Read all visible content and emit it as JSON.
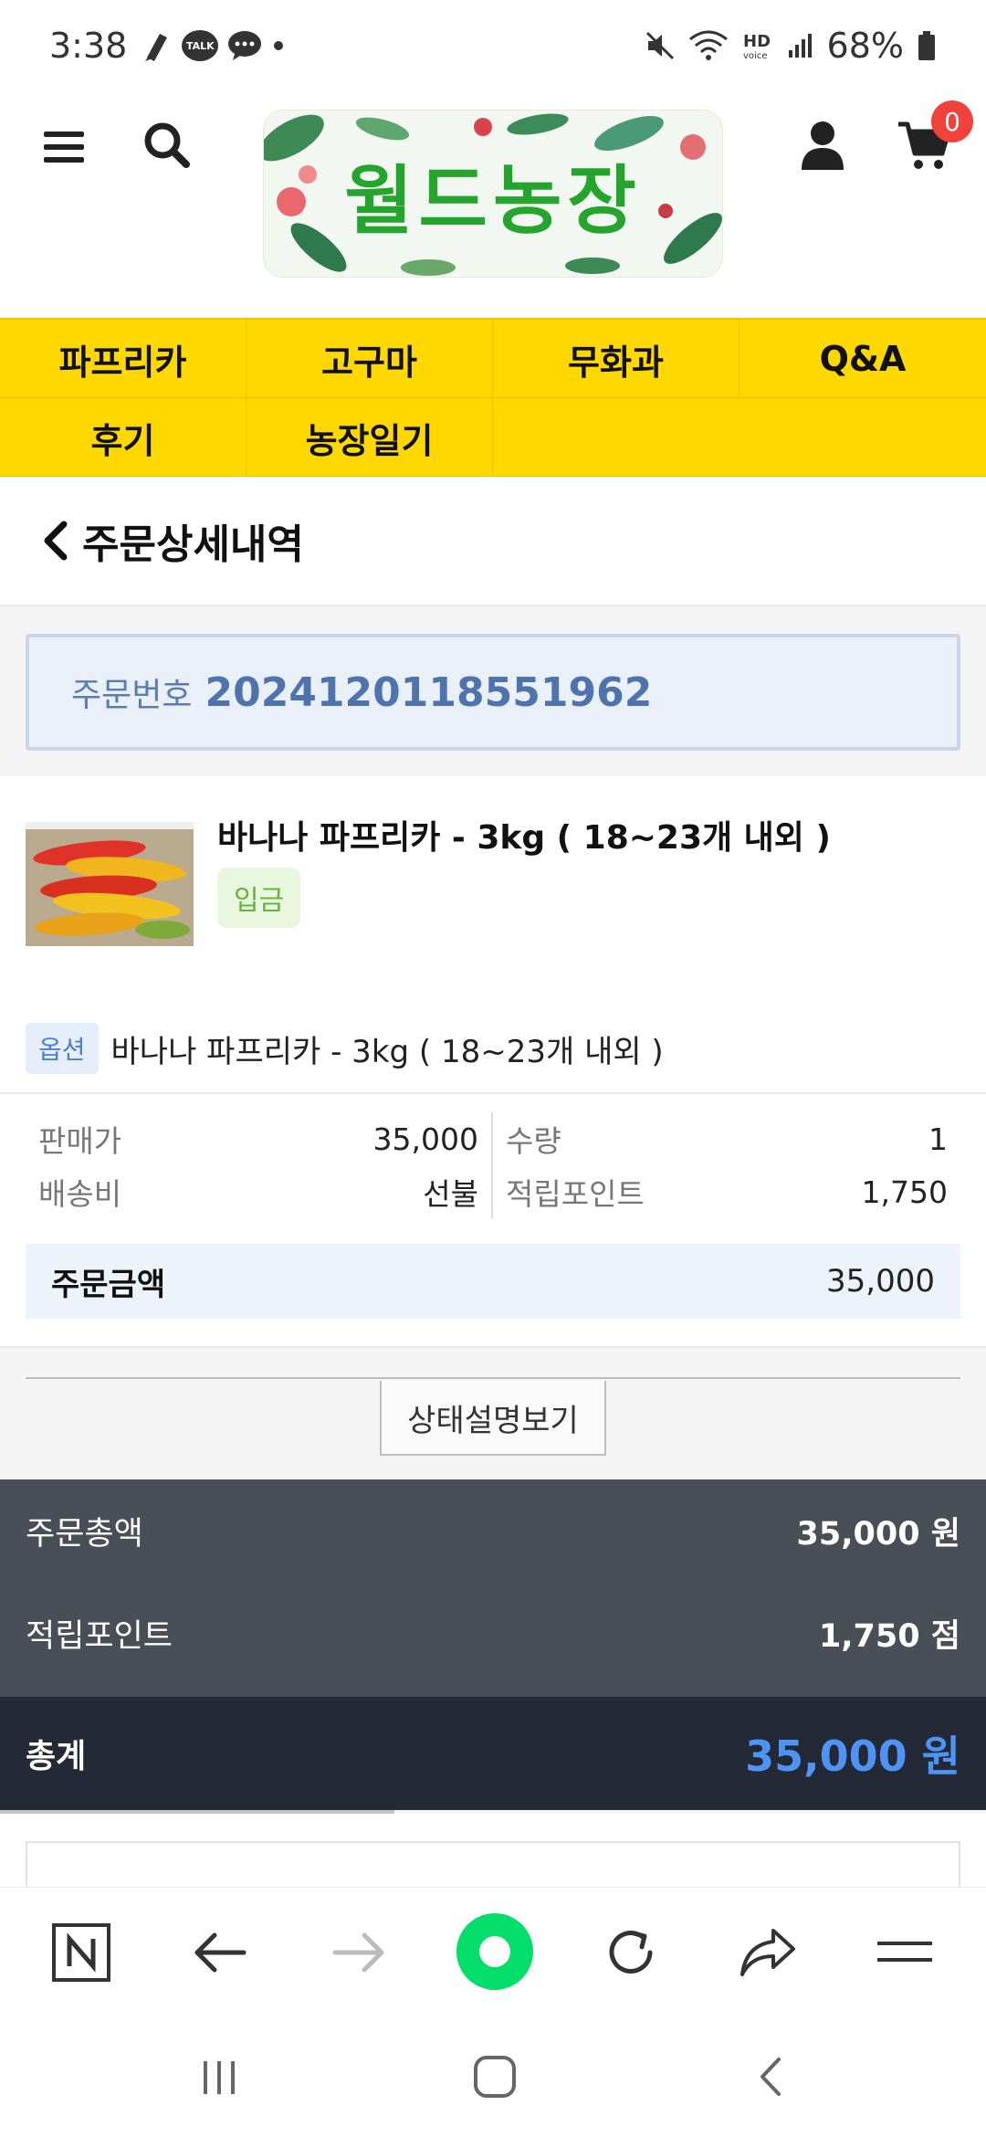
{
  "status_bar": {
    "time": "3:38",
    "battery_pct": "68%",
    "talk_label": "TALK",
    "icons": [
      "notification-pen-icon",
      "kakaotalk-icon",
      "message-icon",
      "dot-icon",
      "mute-icon",
      "wifi-icon",
      "hd-voice-icon",
      "signal-icon",
      "battery-icon"
    ]
  },
  "header": {
    "logo_text": "월드농장",
    "cart_count": "0",
    "icons": [
      "menu-icon",
      "search-icon",
      "user-icon",
      "cart-icon"
    ]
  },
  "nav": {
    "row1": [
      "파프리카",
      "고구마",
      "무화과",
      "Q&A"
    ],
    "row2": [
      "후기",
      "농장일기"
    ]
  },
  "page": {
    "title": "주문상세내역"
  },
  "order": {
    "number_label": "주문번호",
    "number": "2024120118551962",
    "product_name": "바나나 파프리카 - 3kg ( 18~23개 내외 )",
    "status": "입금",
    "option_tag": "옵션",
    "option_text": "바나나 파프리카 - 3kg ( 18~23개 내외 )",
    "price_label": "판매가",
    "price": "35,000",
    "shipping_label": "배송비",
    "shipping": "선불",
    "qty_label": "수량",
    "qty": "1",
    "points_label": "적립포인트",
    "points": "1,750",
    "amount_label": "주문금액",
    "amount": "35,000",
    "status_button": "상태설명보기"
  },
  "summary": {
    "total_label": "주문총액",
    "total": "35,000 원",
    "points_label": "적립포인트",
    "points": "1,750 점",
    "grand_label": "총계",
    "grand": "35,000 원"
  },
  "browser_bar": {
    "icons": [
      "naver-n-icon",
      "back-arrow-icon",
      "forward-arrow-icon",
      "green-dot-icon",
      "refresh-icon",
      "share-icon",
      "hamburger-icon"
    ]
  },
  "system_nav": {
    "icons": [
      "recent-apps-icon",
      "home-icon",
      "back-icon"
    ]
  },
  "colors": {
    "nav_bg": "#ffd800",
    "summary_bg": "#4a4e57",
    "total_bg": "#232a35",
    "total_value": "#4f93f5",
    "badge_red": "#f0423a",
    "brand_green": "#03de6a"
  }
}
